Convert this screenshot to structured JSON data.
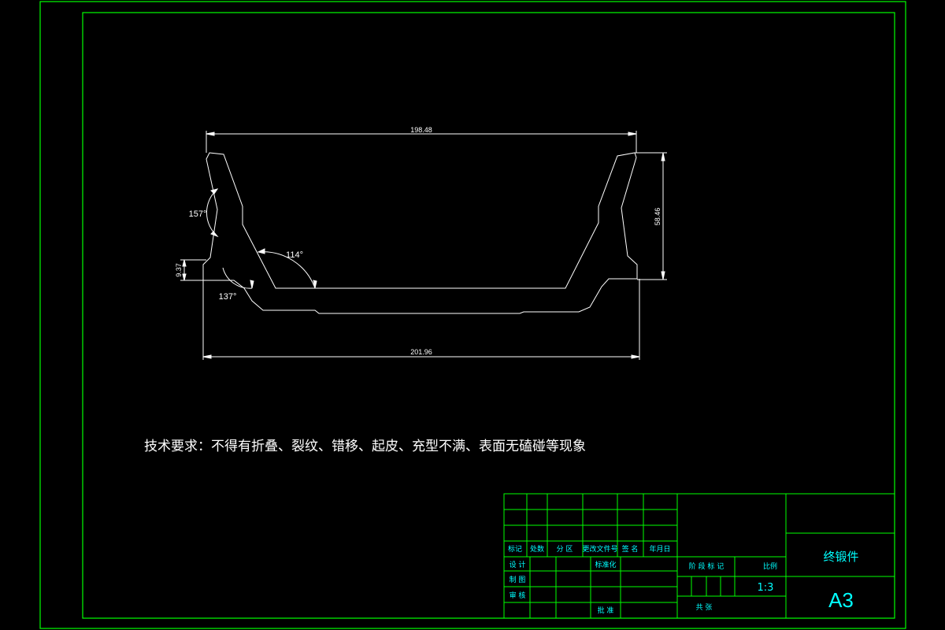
{
  "drawing": {
    "dimensions": {
      "top_width": "198.48",
      "bottom_width": "201.96",
      "height": "58.46",
      "flange_height": "9.37"
    },
    "angles": {
      "left_outer": "157°",
      "inner_wall": "114°",
      "lower_corner": "137°"
    },
    "technical_requirements": "技术要求：不得有折叠、裂纹、错移、起皮、充型不满、表面无磕碰等现象"
  },
  "title_block": {
    "headers": {
      "mark": "标记",
      "count": "处数",
      "zone": "分 区",
      "change_doc": "更改文件号",
      "signature": "签 名",
      "date": "年月日"
    },
    "design": "设 计",
    "standardization": "标准化",
    "drafting": "制 图",
    "review": "审 核",
    "approval": "批 准",
    "stage_mark": "阶 段 标 记",
    "scale_label": "比例",
    "scale_value": "1:3",
    "total_sheets": "共 张",
    "part_name": "终锻件",
    "sheet_size": "A3"
  },
  "colors": {
    "background": "#000000",
    "frame": "#00ff00",
    "outline": "#ffffff",
    "title_text": "#00ffff"
  }
}
